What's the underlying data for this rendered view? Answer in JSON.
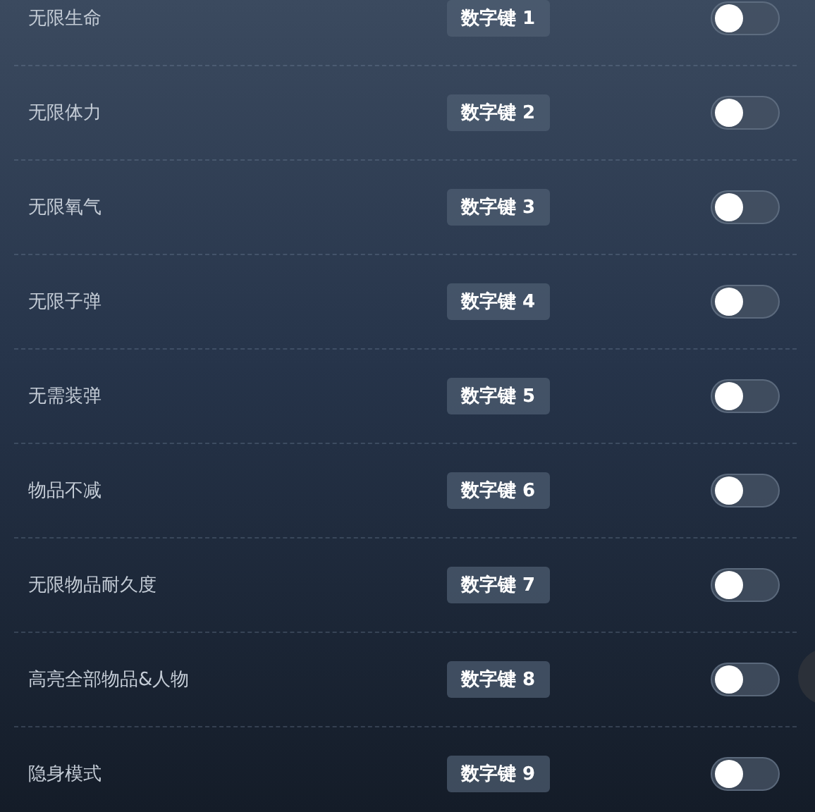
{
  "cheats": [
    {
      "label": "无限生命",
      "hotkey": "数字键 1",
      "on": false
    },
    {
      "label": "无限体力",
      "hotkey": "数字键 2",
      "on": false
    },
    {
      "label": "无限氧气",
      "hotkey": "数字键 3",
      "on": false
    },
    {
      "label": "无限子弹",
      "hotkey": "数字键 4",
      "on": false
    },
    {
      "label": "无需装弹",
      "hotkey": "数字键 5",
      "on": false
    },
    {
      "label": "物品不减",
      "hotkey": "数字键 6",
      "on": false
    },
    {
      "label": "无限物品耐久度",
      "hotkey": "数字键 7",
      "on": false
    },
    {
      "label": "高亮全部物品&人物",
      "hotkey": "数字键 8",
      "on": false
    },
    {
      "label": "隐身模式",
      "hotkey": "数字键 9",
      "on": false
    }
  ]
}
